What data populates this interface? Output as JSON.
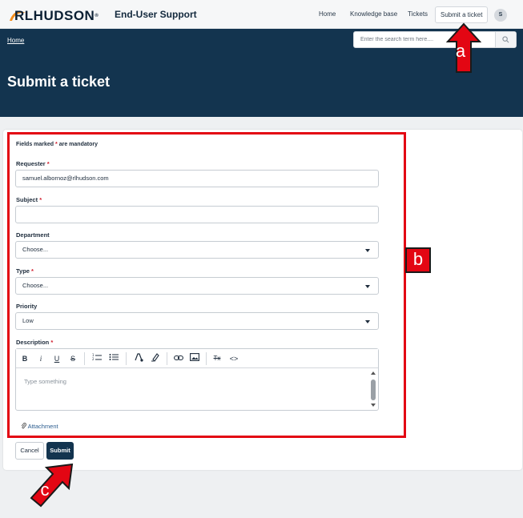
{
  "header": {
    "logo_text": "RLHUDSON",
    "logo_mark": "®",
    "app_title": "End-User Support",
    "nav": {
      "home": "Home",
      "knowledge_base": "Knowledge base",
      "tickets": "Tickets",
      "submit_ticket": "Submit a ticket"
    },
    "avatar_initial": "S"
  },
  "hero": {
    "breadcrumb": "Home",
    "search_placeholder": "Enter the search term here....",
    "title": "Submit a ticket"
  },
  "form": {
    "mandatory_note_prefix": "Fields marked",
    "mandatory_note_star": "*",
    "mandatory_note_suffix": "are mandatory",
    "requester": {
      "label": "Requester",
      "required": "*",
      "value": "samuel.albornoz@rlhudson.com"
    },
    "subject": {
      "label": "Subject",
      "required": "*",
      "value": ""
    },
    "department": {
      "label": "Department",
      "value": "Choose..."
    },
    "type": {
      "label": "Type",
      "required": "*",
      "value": "Choose..."
    },
    "priority": {
      "label": "Priority",
      "value": "Low"
    },
    "description": {
      "label": "Description",
      "required": "*",
      "placeholder": "Type something",
      "toolbar": {
        "bold": "B",
        "italic": "i",
        "underline": "U",
        "strikethrough": "S",
        "clear_format": "Tx",
        "code": "<>"
      }
    },
    "attachment": "Attachment",
    "cancel": "Cancel",
    "submit": "Submit"
  },
  "annotations": {
    "a": "a",
    "b": "b",
    "c": "c",
    "color": "#e30613"
  },
  "colors": {
    "hero_bg": "#13344f",
    "accent": "#13344f",
    "required": "#d11a2a",
    "link": "#2c5d8f"
  }
}
